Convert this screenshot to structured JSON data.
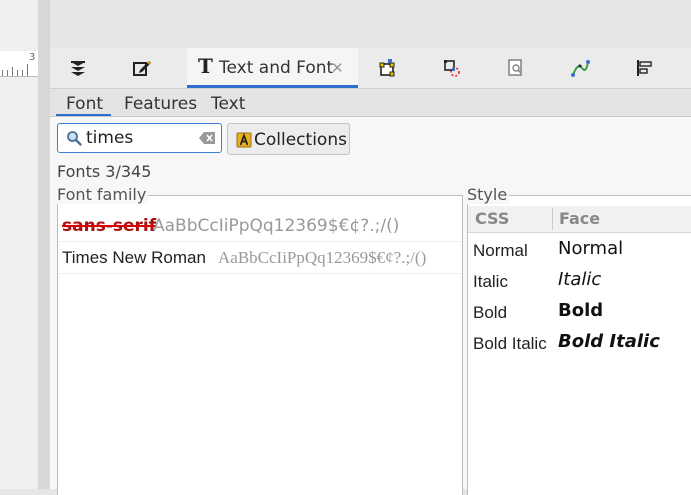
{
  "canvas": {
    "ruler_number": "3"
  },
  "toolbar": {
    "icons": [
      "layers-icon",
      "xml-editor-icon",
      "text-font-icon",
      "fill-stroke-icon",
      "transform-icon",
      "find-icon",
      "path-effects-icon",
      "align-icon"
    ],
    "active_tab": {
      "label": "Text and Font",
      "icon_glyph": "T",
      "close_glyph": "✕"
    },
    "accent_color": "#2e6fd0"
  },
  "subtabs": {
    "font": "Font",
    "features": "Features",
    "text": "Text",
    "active": "Font"
  },
  "search": {
    "value": "times",
    "placeholder": ""
  },
  "collections_button": {
    "label": "Collections"
  },
  "fonts_count": "Fonts 3/345",
  "font_family": {
    "legend": "Font family",
    "items": [
      {
        "name": "sans-serif",
        "sample": "AaBbCcIiPpQq12369$€¢?.;/()",
        "missing": true
      },
      {
        "name": "Times New Roman",
        "sample": "AaBbCcIiPpQq12369$€¢?.;/()",
        "missing": false
      }
    ]
  },
  "style": {
    "legend": "Style",
    "columns": {
      "css": "CSS",
      "face": "Face"
    },
    "rows": [
      {
        "css": "Normal",
        "face": "Normal"
      },
      {
        "css": "Italic",
        "face": "Italic"
      },
      {
        "css": "Bold",
        "face": "Bold"
      },
      {
        "css": "Bold Italic",
        "face": "Bold Italic"
      }
    ]
  }
}
